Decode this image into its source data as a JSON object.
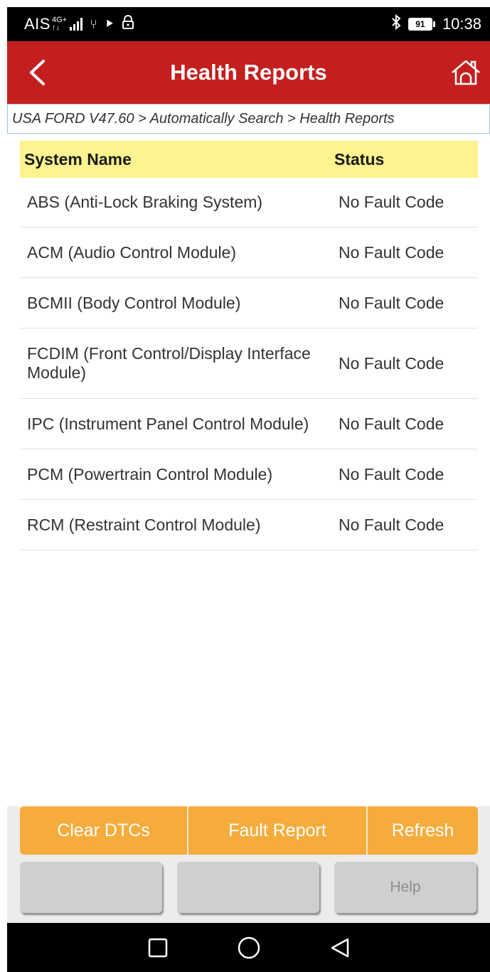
{
  "status_bar": {
    "carrier": "AIS",
    "network_top": "4G+",
    "network_bottom": "↑↓",
    "battery": "91",
    "time": "10:38",
    "icons": [
      "signal-icon",
      "usb-icon",
      "play-icon",
      "lock-icon",
      "bluetooth-icon",
      "battery-icon"
    ]
  },
  "header": {
    "title": "Health Reports",
    "back_icon": "chevron-left-icon",
    "home_icon": "home-icon",
    "color": "#c41f1f"
  },
  "breadcrumb": "USA FORD V47.60 > Automatically Search > Health Reports",
  "table": {
    "columns": [
      "System Name",
      "Status"
    ],
    "header_color": "#fdf38f",
    "rows": [
      {
        "name": "ABS (Anti-Lock Braking System)",
        "status": "No Fault Code"
      },
      {
        "name": "ACM (Audio Control Module)",
        "status": "No Fault Code"
      },
      {
        "name": "BCMII (Body Control Module)",
        "status": "No Fault Code"
      },
      {
        "name": "FCDIM (Front Control/Display Interface Module)",
        "status": "No Fault Code"
      },
      {
        "name": "IPC (Instrument Panel Control Module)",
        "status": "No Fault Code"
      },
      {
        "name": "PCM (Powertrain Control Module)",
        "status": "No Fault Code"
      },
      {
        "name": "RCM (Restraint Control Module)",
        "status": "No Fault Code"
      }
    ]
  },
  "actions": {
    "clear_dtcs": "Clear DTCs",
    "fault_report": "Fault Report",
    "refresh": "Refresh",
    "blank_1": "",
    "blank_2": "",
    "help": "Help",
    "accent_color": "#f6ac3c"
  },
  "nav": {
    "recent_icon": "square-icon",
    "home_icon": "circle-icon",
    "back_icon": "triangle-back-icon"
  }
}
